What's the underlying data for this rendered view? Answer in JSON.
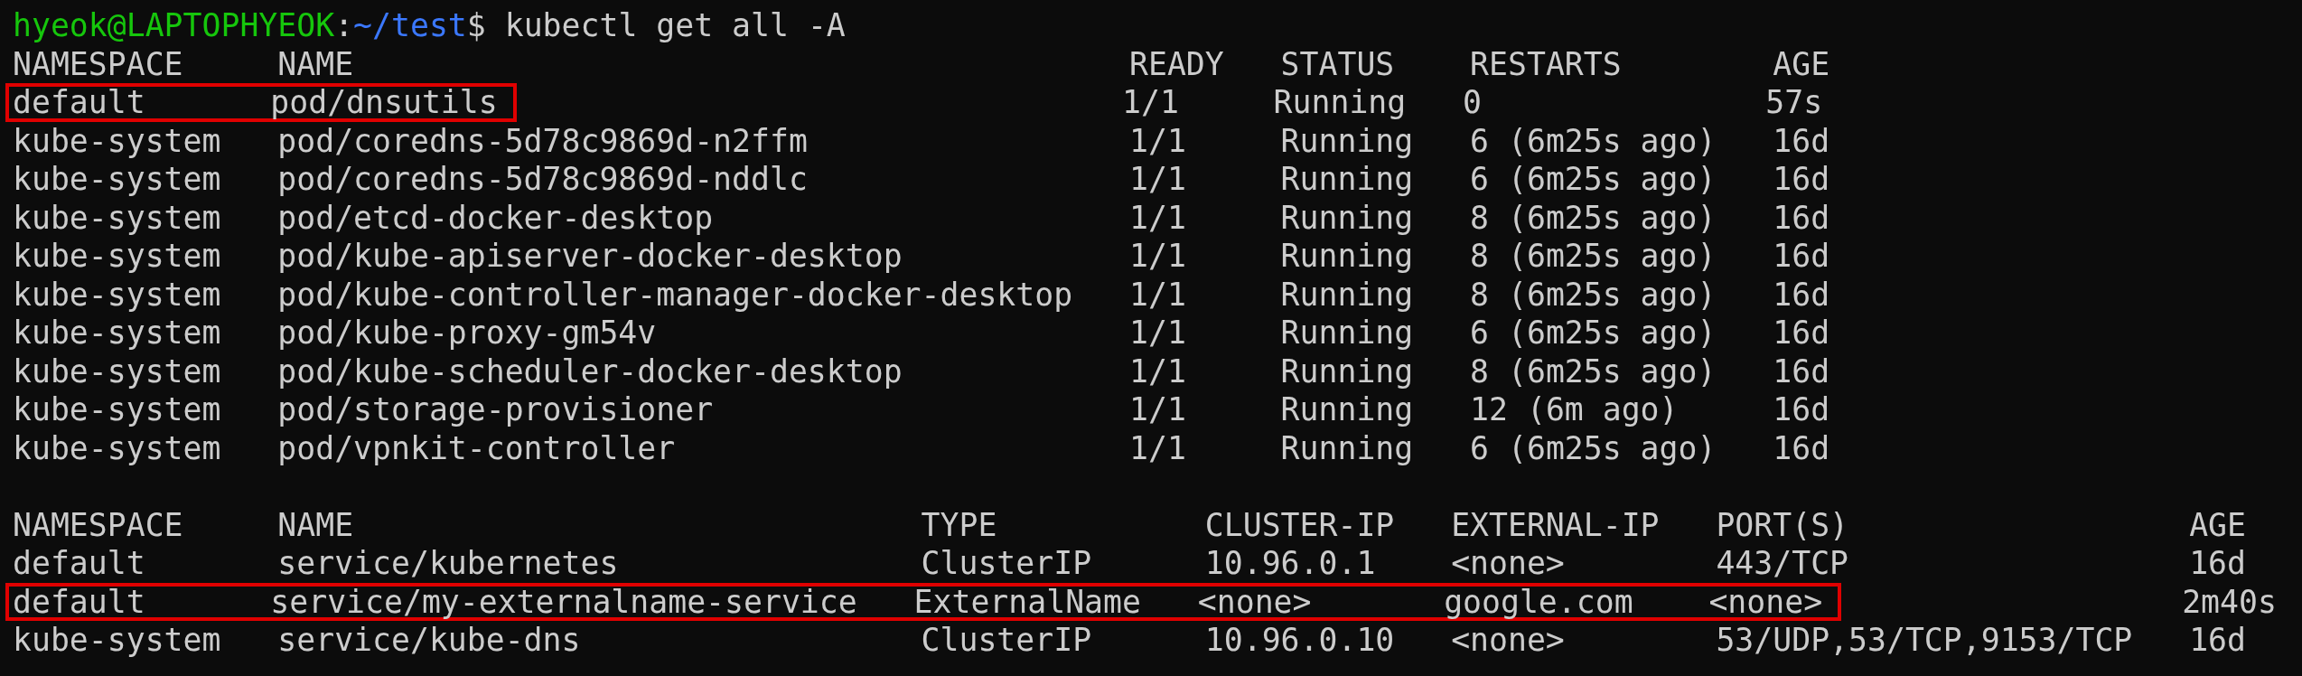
{
  "prompt": {
    "user_host": "hyeok@LAPTOPHYEOK",
    "separator": ":",
    "path": "~/test",
    "command": "$ kubectl get all -A"
  },
  "tables": [
    {
      "columns": [
        "NAMESPACE",
        "NAME",
        "READY",
        "STATUS",
        "RESTARTS",
        "AGE"
      ],
      "rows": [
        {
          "cells": [
            "default",
            "pod/dnsutils",
            "1/1",
            "Running",
            "0",
            "57s"
          ],
          "boxed": [
            true,
            true,
            false,
            false,
            false,
            false
          ]
        },
        {
          "cells": [
            "kube-system",
            "pod/coredns-5d78c9869d-n2ffm",
            "1/1",
            "Running",
            "6 (6m25s ago)",
            "16d"
          ]
        },
        {
          "cells": [
            "kube-system",
            "pod/coredns-5d78c9869d-nddlc",
            "1/1",
            "Running",
            "6 (6m25s ago)",
            "16d"
          ]
        },
        {
          "cells": [
            "kube-system",
            "pod/etcd-docker-desktop",
            "1/1",
            "Running",
            "8 (6m25s ago)",
            "16d"
          ]
        },
        {
          "cells": [
            "kube-system",
            "pod/kube-apiserver-docker-desktop",
            "1/1",
            "Running",
            "8 (6m25s ago)",
            "16d"
          ]
        },
        {
          "cells": [
            "kube-system",
            "pod/kube-controller-manager-docker-desktop",
            "1/1",
            "Running",
            "8 (6m25s ago)",
            "16d"
          ]
        },
        {
          "cells": [
            "kube-system",
            "pod/kube-proxy-gm54v",
            "1/1",
            "Running",
            "6 (6m25s ago)",
            "16d"
          ]
        },
        {
          "cells": [
            "kube-system",
            "pod/kube-scheduler-docker-desktop",
            "1/1",
            "Running",
            "8 (6m25s ago)",
            "16d"
          ]
        },
        {
          "cells": [
            "kube-system",
            "pod/storage-provisioner",
            "1/1",
            "Running",
            "12 (6m ago)",
            "16d"
          ]
        },
        {
          "cells": [
            "kube-system",
            "pod/vpnkit-controller",
            "1/1",
            "Running",
            "6 (6m25s ago)",
            "16d"
          ]
        }
      ]
    },
    {
      "columns": [
        "NAMESPACE",
        "NAME",
        "TYPE",
        "CLUSTER-IP",
        "EXTERNAL-IP",
        "PORT(S)",
        "AGE"
      ],
      "rows": [
        {
          "cells": [
            "default",
            "service/kubernetes",
            "ClusterIP",
            "10.96.0.1",
            "<none>",
            "443/TCP",
            "16d"
          ]
        },
        {
          "cells": [
            "default",
            "service/my-externalname-service",
            "ExternalName",
            "<none>",
            "google.com",
            "<none>",
            "2m40s"
          ],
          "boxed": [
            true,
            true,
            true,
            true,
            true,
            true,
            false
          ]
        },
        {
          "cells": [
            "kube-system",
            "service/kube-dns",
            "ClusterIP",
            "10.96.0.10",
            "<none>",
            "53/UDP,53/TCP,9153/TCP",
            "16d"
          ]
        }
      ]
    }
  ]
}
